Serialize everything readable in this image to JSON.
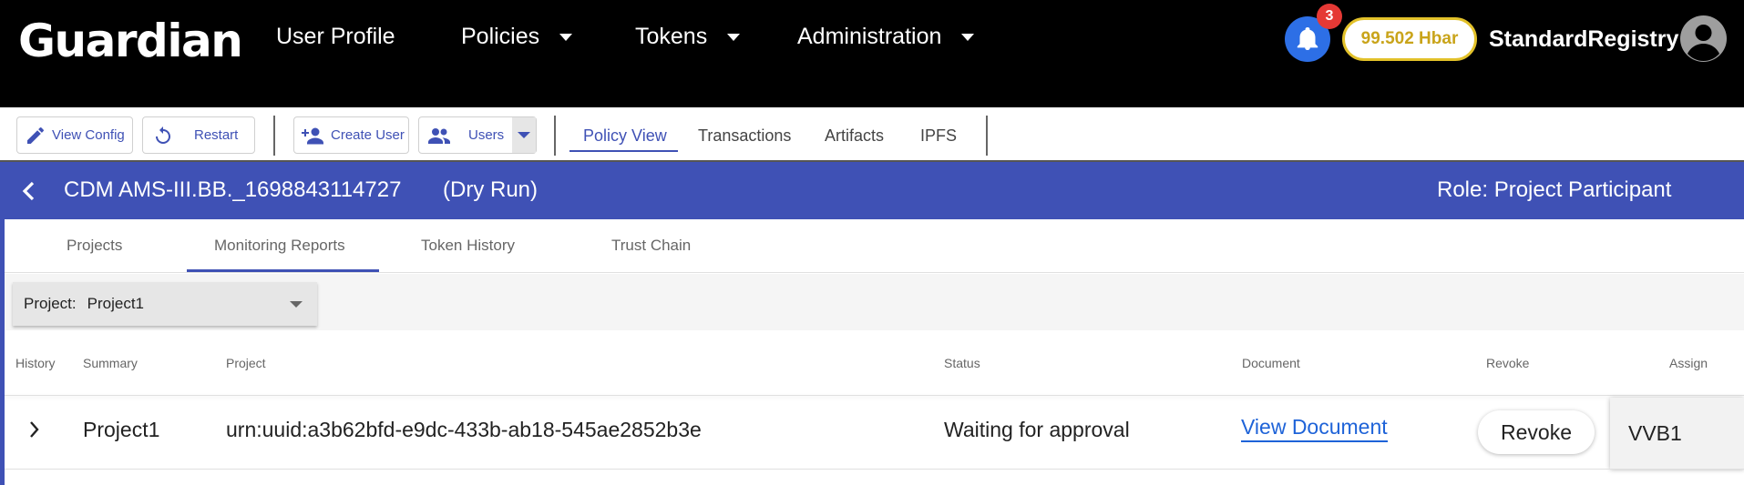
{
  "header": {
    "logo": "Guardian",
    "nav": [
      {
        "label": "User Profile"
      },
      {
        "label": "Policies"
      },
      {
        "label": "Tokens"
      },
      {
        "label": "Administration"
      }
    ],
    "notifications_count": "3",
    "balance": "99.502 Hbar",
    "username": "StandardRegistry"
  },
  "toolbar": {
    "view_config": "View Config",
    "restart": "Restart",
    "create_user": "Create User",
    "users": "Users",
    "tabs": [
      "Policy View",
      "Transactions",
      "Artifacts",
      "IPFS"
    ],
    "active_tab": "Policy View"
  },
  "banner": {
    "policy_name": "CDM AMS-III.BB._1698843114727",
    "mode": "(Dry Run)",
    "role": "Role: Project Participant"
  },
  "content_tabs": {
    "items": [
      "Projects",
      "Monitoring Reports",
      "Token History",
      "Trust Chain"
    ],
    "active": "Monitoring Reports"
  },
  "filter": {
    "label": "Project:",
    "value": "Project1"
  },
  "table": {
    "columns": [
      "History",
      "Summary",
      "Project",
      "Status",
      "Document",
      "Revoke",
      "Assign"
    ],
    "rows": [
      {
        "summary": "Project1",
        "project": "urn:uuid:a3b62bfd-e9dc-433b-ab18-545ae2852b3e",
        "status": "Waiting for approval",
        "document": "View Document",
        "revoke": "Revoke",
        "assign": "VVB1"
      }
    ]
  },
  "colors": {
    "header_bg": "#000000",
    "accent": "#3f51b5",
    "bell": "#2d6fe6",
    "badge": "#e53935",
    "balance_border": "#e2c12a",
    "link": "#1e63d8"
  }
}
